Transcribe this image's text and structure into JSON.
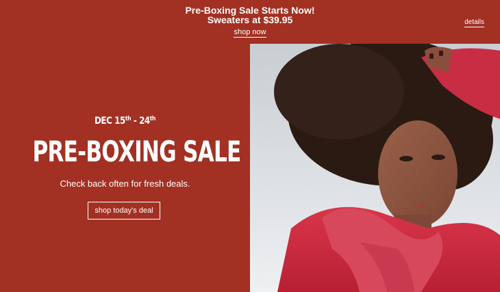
{
  "promo": {
    "line1": "Pre-Boxing Sale Starts Now!",
    "line2": "Sweaters at $39.95",
    "link_label": "shop now",
    "details_label": "details"
  },
  "hero": {
    "dates_prefix": "DEC 15",
    "dates_sup1": "th",
    "dates_sep": " - 24",
    "dates_sup2": "th",
    "headline": "PRE-BOXING SALE",
    "subline": "Check back often for fresh deals.",
    "cta_label": "shop today's deal"
  },
  "colors": {
    "brand_red": "#a23123",
    "text": "#ffffff"
  }
}
